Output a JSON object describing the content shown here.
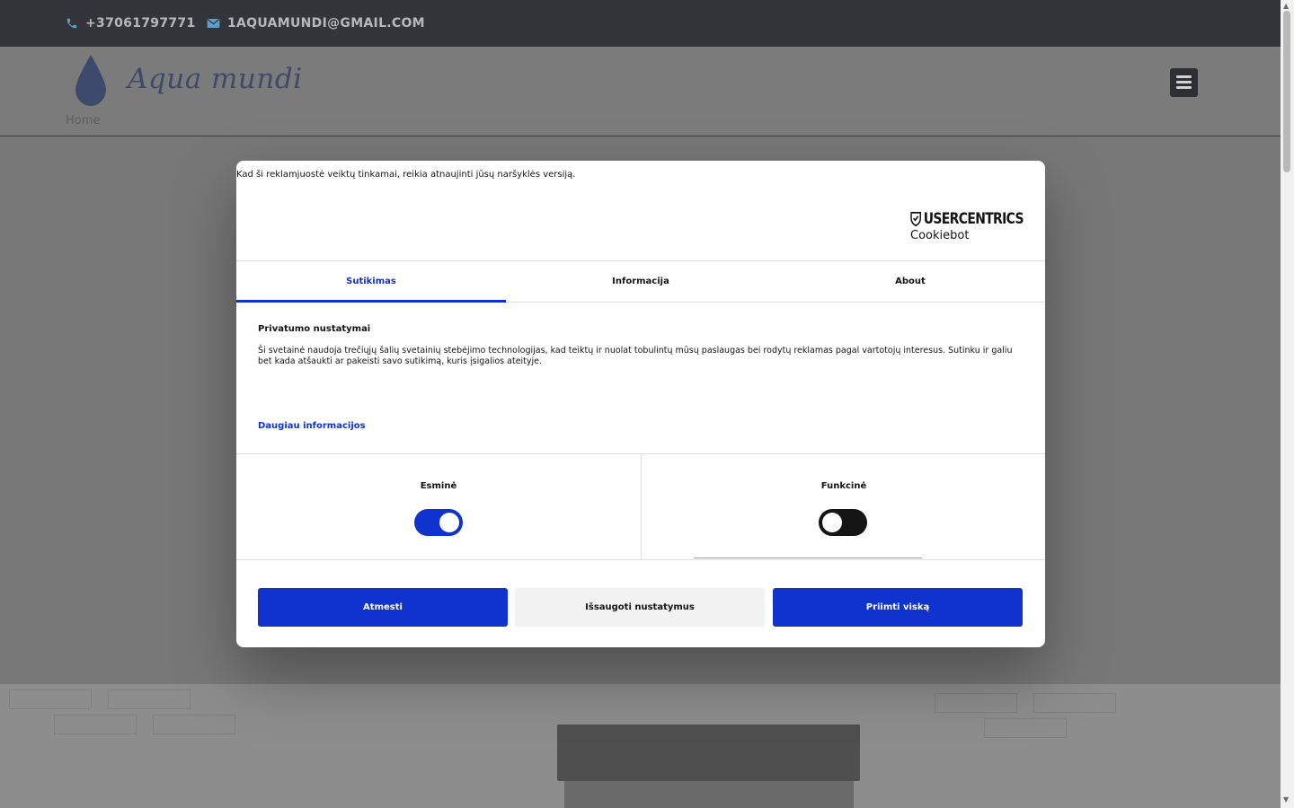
{
  "contact": {
    "phone": "+37061797771",
    "email": "1AQUAMUNDI@GMAIL.COM"
  },
  "brand": {
    "name": "Aqua mundi"
  },
  "nav": {
    "home": "Home"
  },
  "cookie_dialog": {
    "notice": "Kad ši reklamjuostė veiktų tinkamai, reikia atnaujinti jūsų naršyklės versiją.",
    "logo": {
      "top": "USERCENTRICS",
      "bottom": "Cookiebot"
    },
    "tabs": [
      {
        "label": "Sutikimas",
        "active": true
      },
      {
        "label": "Informacija",
        "active": false
      },
      {
        "label": "About",
        "active": false
      }
    ],
    "title": "Privatumo nustatymai",
    "body": "Ši svetainė naudoja trečiųjų šalių svetainių stebėjimo technologijas, kad teiktų ir nuolat tobulintų mūsų paslaugas bei rodytų reklamas pagal vartotojų interesus. Sutinku ir galiu bet kada atšaukti ar pakeisti savo sutikimą, kuris įsigalios ateityje.",
    "more_link": "Daugiau informacijos",
    "toggles": [
      {
        "label": "Esminė",
        "on": true
      },
      {
        "label": "Funkcinė",
        "on": false
      }
    ],
    "buttons": {
      "reject": "Atmesti",
      "save": "Išsaugoti nustatymus",
      "accept": "Priimti viską"
    }
  },
  "colors": {
    "accent": "#1032cf",
    "topbar": "#34353b",
    "toggle_on": "#1032cf",
    "toggle_off": "#141414"
  }
}
